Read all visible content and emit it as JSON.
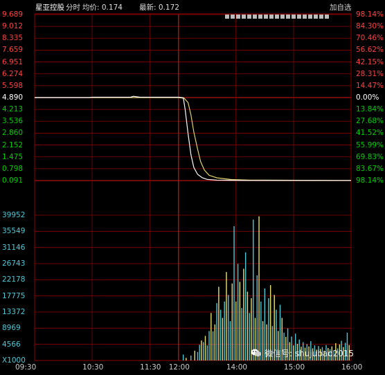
{
  "header": {
    "stock_name": "星亚控股",
    "mode": "分时",
    "avg_label": "均价: 0.174",
    "last_label": "最新: 0.172",
    "add_watch": "加自选"
  },
  "watermark": {
    "text": "微信号: shujubao2015",
    "icon": "wechat-icon"
  },
  "colors": {
    "background": "#000000",
    "grid_red": "#8b0000",
    "up": "#ff4040",
    "down": "#00d000",
    "price_line": "#ffffff",
    "avg_line": "#e0d070",
    "vol_cyan": "#4ec9d8",
    "vol_yellow": "#e8e070"
  },
  "chart_data": [
    {
      "type": "line",
      "name": "price",
      "y_labels_left": [
        "9.689",
        "9.012",
        "8.335",
        "7.659",
        "6.951",
        "6.274",
        "5.598",
        "4.890",
        "4.213",
        "3.536",
        "2.860",
        "2.152",
        "1.475",
        "0.798",
        "0.091"
      ],
      "y_labels_right": [
        "98.14%",
        "84.30%",
        "70.46%",
        "56.62%",
        "42.15%",
        "28.31%",
        "14.47%",
        "0.00%",
        "13.84%",
        "27.68%",
        "41.52%",
        "55.99%",
        "69.83%",
        "83.67%",
        "98.14%"
      ],
      "ylim": [
        0.091,
        9.689
      ],
      "prev_close": 4.89,
      "x_ticks": [
        "09:30",
        "10:30",
        "11:30",
        "12:00",
        "14:00",
        "15:00",
        "16:00"
      ],
      "session_minutes": 330,
      "tick_minutes": [
        0,
        60,
        120,
        150,
        210,
        270,
        330
      ],
      "series_price": [
        [
          0,
          4.89
        ],
        [
          57,
          4.89
        ],
        [
          60,
          4.91
        ],
        [
          100,
          4.91
        ],
        [
          103,
          4.96
        ],
        [
          107,
          4.93
        ],
        [
          110,
          4.91
        ],
        [
          150,
          4.91
        ],
        [
          155,
          4.88
        ],
        [
          157,
          4.2
        ],
        [
          160,
          2.8
        ],
        [
          163,
          1.6
        ],
        [
          166,
          0.85
        ],
        [
          170,
          0.45
        ],
        [
          175,
          0.25
        ],
        [
          180,
          0.16
        ],
        [
          190,
          0.12
        ],
        [
          200,
          0.11
        ],
        [
          220,
          0.1
        ],
        [
          260,
          0.1
        ],
        [
          300,
          0.1
        ],
        [
          330,
          0.1
        ]
      ],
      "series_avg": [
        [
          0,
          4.89
        ],
        [
          150,
          4.89
        ],
        [
          156,
          4.85
        ],
        [
          160,
          4.6
        ],
        [
          163,
          3.9
        ],
        [
          166,
          2.9
        ],
        [
          170,
          1.9
        ],
        [
          173,
          1.2
        ],
        [
          177,
          0.7
        ],
        [
          182,
          0.4
        ],
        [
          190,
          0.25
        ],
        [
          205,
          0.15
        ],
        [
          225,
          0.12
        ],
        [
          260,
          0.11
        ],
        [
          330,
          0.1
        ]
      ]
    },
    {
      "type": "bar",
      "name": "volume",
      "y_labels": [
        "39952",
        "35549",
        "31146",
        "26743",
        "22178",
        "17775",
        "13372",
        "8969",
        "4566",
        "X1000"
      ],
      "ylim": [
        0,
        44355
      ],
      "volume_unit": "X1000",
      "bars": [
        [
          155,
          1800,
          "c"
        ],
        [
          158,
          800,
          "y"
        ],
        [
          163,
          1500,
          "c"
        ],
        [
          167,
          3000,
          "y"
        ],
        [
          170,
          2600,
          "c"
        ],
        [
          172,
          4800,
          "c"
        ],
        [
          174,
          6100,
          "y"
        ],
        [
          176,
          5600,
          "c"
        ],
        [
          178,
          7500,
          "y"
        ],
        [
          180,
          4600,
          "c"
        ],
        [
          182,
          9000,
          "c"
        ],
        [
          184,
          14500,
          "y"
        ],
        [
          186,
          8900,
          "c"
        ],
        [
          188,
          11000,
          "y"
        ],
        [
          190,
          17500,
          "c"
        ],
        [
          192,
          22500,
          "y"
        ],
        [
          194,
          15500,
          "c"
        ],
        [
          196,
          13000,
          "y"
        ],
        [
          198,
          18000,
          "c"
        ],
        [
          200,
          27000,
          "y"
        ],
        [
          202,
          20000,
          "c"
        ],
        [
          204,
          12000,
          "c"
        ],
        [
          206,
          23500,
          "y"
        ],
        [
          208,
          41000,
          "c"
        ],
        [
          210,
          18000,
          "y"
        ],
        [
          212,
          29500,
          "c"
        ],
        [
          214,
          24000,
          "y"
        ],
        [
          216,
          16000,
          "c"
        ],
        [
          218,
          28000,
          "y"
        ],
        [
          220,
          33000,
          "c"
        ],
        [
          222,
          21000,
          "y"
        ],
        [
          224,
          14500,
          "c"
        ],
        [
          226,
          19000,
          "y"
        ],
        [
          228,
          43000,
          "c"
        ],
        [
          230,
          13000,
          "y"
        ],
        [
          232,
          26000,
          "c"
        ],
        [
          234,
          44000,
          "y"
        ],
        [
          236,
          18000,
          "c"
        ],
        [
          238,
          12000,
          "y"
        ],
        [
          240,
          22000,
          "c"
        ],
        [
          242,
          11000,
          "y"
        ],
        [
          244,
          19000,
          "c"
        ],
        [
          246,
          23000,
          "y"
        ],
        [
          248,
          10500,
          "c"
        ],
        [
          250,
          20000,
          "y"
        ],
        [
          252,
          15500,
          "c"
        ],
        [
          254,
          9000,
          "y"
        ],
        [
          256,
          17000,
          "c"
        ],
        [
          258,
          13000,
          "y"
        ],
        [
          260,
          8500,
          "c"
        ],
        [
          262,
          7200,
          "y"
        ],
        [
          264,
          9800,
          "c"
        ],
        [
          266,
          5600,
          "y"
        ],
        [
          268,
          7300,
          "c"
        ],
        [
          270,
          4600,
          "y"
        ],
        [
          272,
          8200,
          "c"
        ],
        [
          274,
          5100,
          "y"
        ],
        [
          276,
          6400,
          "c"
        ],
        [
          278,
          4200,
          "y"
        ],
        [
          280,
          5600,
          "c"
        ],
        [
          282,
          3900,
          "y"
        ],
        [
          284,
          5000,
          "c"
        ],
        [
          286,
          4300,
          "y"
        ],
        [
          288,
          5900,
          "c"
        ],
        [
          290,
          3700,
          "y"
        ],
        [
          292,
          4600,
          "c"
        ],
        [
          294,
          3300,
          "y"
        ],
        [
          296,
          4400,
          "c"
        ],
        [
          298,
          3500,
          "y"
        ],
        [
          300,
          4100,
          "c"
        ],
        [
          302,
          3000,
          "y"
        ],
        [
          304,
          4700,
          "c"
        ],
        [
          306,
          3800,
          "y"
        ],
        [
          308,
          3400,
          "c"
        ],
        [
          310,
          4300,
          "y"
        ],
        [
          312,
          3100,
          "c"
        ],
        [
          314,
          5300,
          "y"
        ],
        [
          316,
          3700,
          "c"
        ],
        [
          318,
          4900,
          "y"
        ],
        [
          320,
          6000,
          "c"
        ],
        [
          322,
          4100,
          "y"
        ],
        [
          324,
          5400,
          "c"
        ],
        [
          326,
          8500,
          "c"
        ],
        [
          328,
          4700,
          "y"
        ]
      ]
    }
  ]
}
